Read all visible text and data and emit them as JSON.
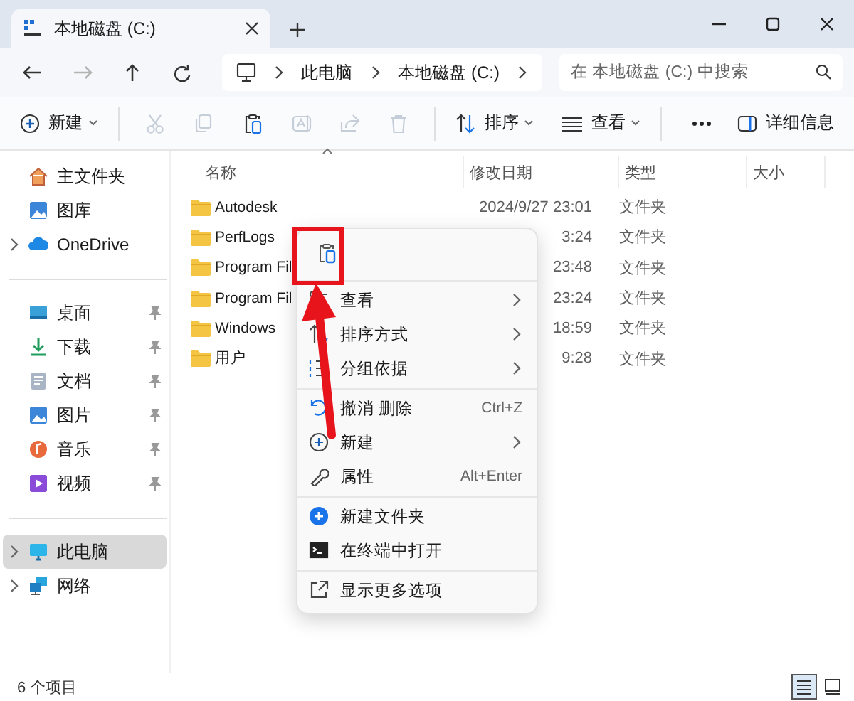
{
  "window": {
    "tab_title": "本地磁盘 (C:)"
  },
  "nav_buttons": [
    {
      "disabled": false
    },
    {
      "disabled": true
    },
    {
      "disabled": false
    },
    {
      "disabled": false
    }
  ],
  "address": {
    "crumbs": [
      "此电脑",
      "本地磁盘 (C:)"
    ]
  },
  "search": {
    "placeholder": "在 本地磁盘 (C:) 中搜索"
  },
  "toolbar": {
    "new": "新建",
    "actions": [
      {
        "disabled": true
      },
      {
        "disabled": true
      },
      {
        "disabled": false
      },
      {
        "disabled": true
      },
      {
        "disabled": true
      },
      {
        "disabled": true
      }
    ],
    "sort": "排序",
    "view": "查看",
    "details": "详细信息"
  },
  "sidebar": {
    "sections": [
      [
        {
          "label": "主文件夹",
          "pinned": false,
          "expandable": false,
          "selected": false
        },
        {
          "label": "图库",
          "pinned": false,
          "expandable": false,
          "selected": false
        },
        {
          "label": "OneDrive",
          "pinned": false,
          "expandable": true,
          "selected": false
        }
      ],
      [
        {
          "label": "桌面",
          "pinned": true,
          "expandable": false,
          "selected": false
        },
        {
          "label": "下载",
          "pinned": true,
          "expandable": false,
          "selected": false
        },
        {
          "label": "文档",
          "pinned": true,
          "expandable": false,
          "selected": false
        },
        {
          "label": "图片",
          "pinned": true,
          "expandable": false,
          "selected": false
        },
        {
          "label": "音乐",
          "pinned": true,
          "expandable": false,
          "selected": false
        },
        {
          "label": "视频",
          "pinned": true,
          "expandable": false,
          "selected": false
        }
      ],
      [
        {
          "label": "此电脑",
          "pinned": false,
          "expandable": true,
          "selected": true
        },
        {
          "label": "网络",
          "pinned": false,
          "expandable": true,
          "selected": false
        }
      ]
    ]
  },
  "columns": [
    "名称",
    "修改日期",
    "类型",
    "大小"
  ],
  "files": [
    {
      "name": "Autodesk",
      "modified": "2024/9/27 23:01",
      "type": "文件夹"
    },
    {
      "name": "PerfLogs",
      "modified": "3:24",
      "type": "文件夹"
    },
    {
      "name": "Program Fil",
      "modified": "23:48",
      "type": "文件夹"
    },
    {
      "name": "Program Fil",
      "modified": "23:24",
      "type": "文件夹"
    },
    {
      "name": "Windows",
      "modified": "18:59",
      "type": "文件夹"
    },
    {
      "name": "用户",
      "modified": "9:28",
      "type": "文件夹"
    }
  ],
  "context_menu": {
    "groups": [
      [
        {
          "label": "查看",
          "submenu": true
        },
        {
          "label": "排序方式",
          "submenu": true
        },
        {
          "label": "分组依据",
          "submenu": true
        }
      ],
      [
        {
          "label": "撤消 删除",
          "shortcut": "Ctrl+Z",
          "submenu": false
        },
        {
          "label": "新建",
          "submenu": true
        },
        {
          "label": "属性",
          "shortcut": "Alt+Enter",
          "submenu": false
        }
      ],
      [
        {
          "label": "新建文件夹",
          "submenu": false
        },
        {
          "label": "在终端中打开",
          "submenu": false
        }
      ],
      [
        {
          "label": "显示更多选项",
          "submenu": false
        }
      ]
    ]
  },
  "status_bar": {
    "item_count": "6 个项目",
    "views": [
      {
        "selected": true
      },
      {
        "selected": false
      }
    ]
  }
}
